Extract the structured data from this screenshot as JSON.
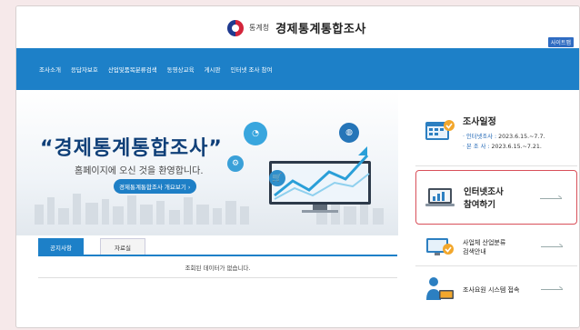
{
  "header": {
    "agency": "통계청",
    "title": "경제통계통합조사",
    "sitemap": "사이트맵"
  },
  "nav": {
    "items": [
      "조사소개",
      "응답자보호",
      "산업및품목분류검색",
      "동영상교육",
      "게시판",
      "인터넷 조사 참여"
    ]
  },
  "hero": {
    "title": "“경제통계통합조사”",
    "subtitle": "홈페이지에 오신 것을 환영합니다.",
    "button": "경제통계통합조사 개요보기 ›"
  },
  "board": {
    "tabs": [
      "공지사항",
      "자료실"
    ],
    "empty_message": "조회된 데이터가 없습니다."
  },
  "sidebar": {
    "schedule": {
      "title": "조사일정",
      "rows": [
        {
          "label": "· 인터넷조사 :",
          "value": "2023.6.15.~7.7."
        },
        {
          "label": "· 본   조   사 :",
          "value": "2023.6.15.~7.21."
        }
      ]
    },
    "internet": {
      "line1": "인터넷조사",
      "line2": "참여하기"
    },
    "industry": {
      "line1": "사업체 산업분류",
      "line2": "검색안내"
    },
    "surveyor": {
      "label": "조사요원 시스템 접속"
    }
  },
  "colors": {
    "nav_bg": "#1d80c8",
    "title_navy": "#0f3f78",
    "highlight_border": "#d9505a",
    "page_bg": "#f6e9ea"
  }
}
